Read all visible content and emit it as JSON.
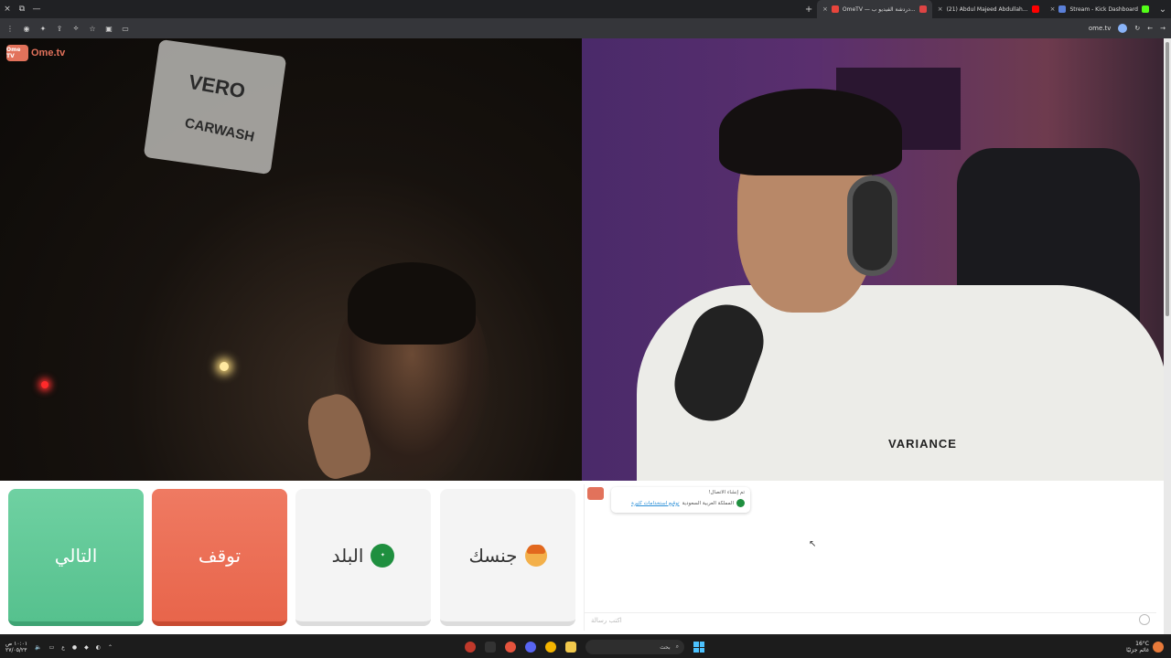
{
  "browser": {
    "window_controls": [
      "×",
      "⧉",
      "—"
    ],
    "tabs": [
      {
        "title": "OmeTV — دردشة الفيديو ب...",
        "active": true,
        "color": "#e8453c"
      },
      {
        "title": "(21) Abdul Majeed Abdullah...",
        "active": false,
        "color": "#ff0000"
      },
      {
        "title": "Stream - Kick Dashboard",
        "active": false,
        "color": "#53fc18"
      }
    ],
    "new_tab_label": "+",
    "address": "ome.tv"
  },
  "app": {
    "logo_text": "Ome.tv",
    "logo_badge": "Ome TV"
  },
  "scene": {
    "sign_line1": "VERO",
    "sign_line2": "CARWASH",
    "shirt_text": "VARIANCE"
  },
  "controls": {
    "next_label": "التالي",
    "stop_label": "توقف",
    "country_label": "البلد",
    "gender_label": "جنسك",
    "colors": {
      "next": "#5cc594",
      "stop": "#e86c52",
      "neutral": "#f4f4f4"
    }
  },
  "chat": {
    "system_message": "تم إنشاء الاتصال!",
    "country_name": "المملكة العربية السعودية",
    "link_text": "توقيع استخدامات كثيرة",
    "input_placeholder": "اكتب رسالة"
  },
  "taskbar": {
    "search_placeholder": "بحث",
    "time": "١٠:٠١ ص",
    "date": "٢٧/٠٥/٢٣",
    "lang": "ع",
    "weather_temp": "16°C",
    "weather_label": "غائم جزئيًا"
  }
}
